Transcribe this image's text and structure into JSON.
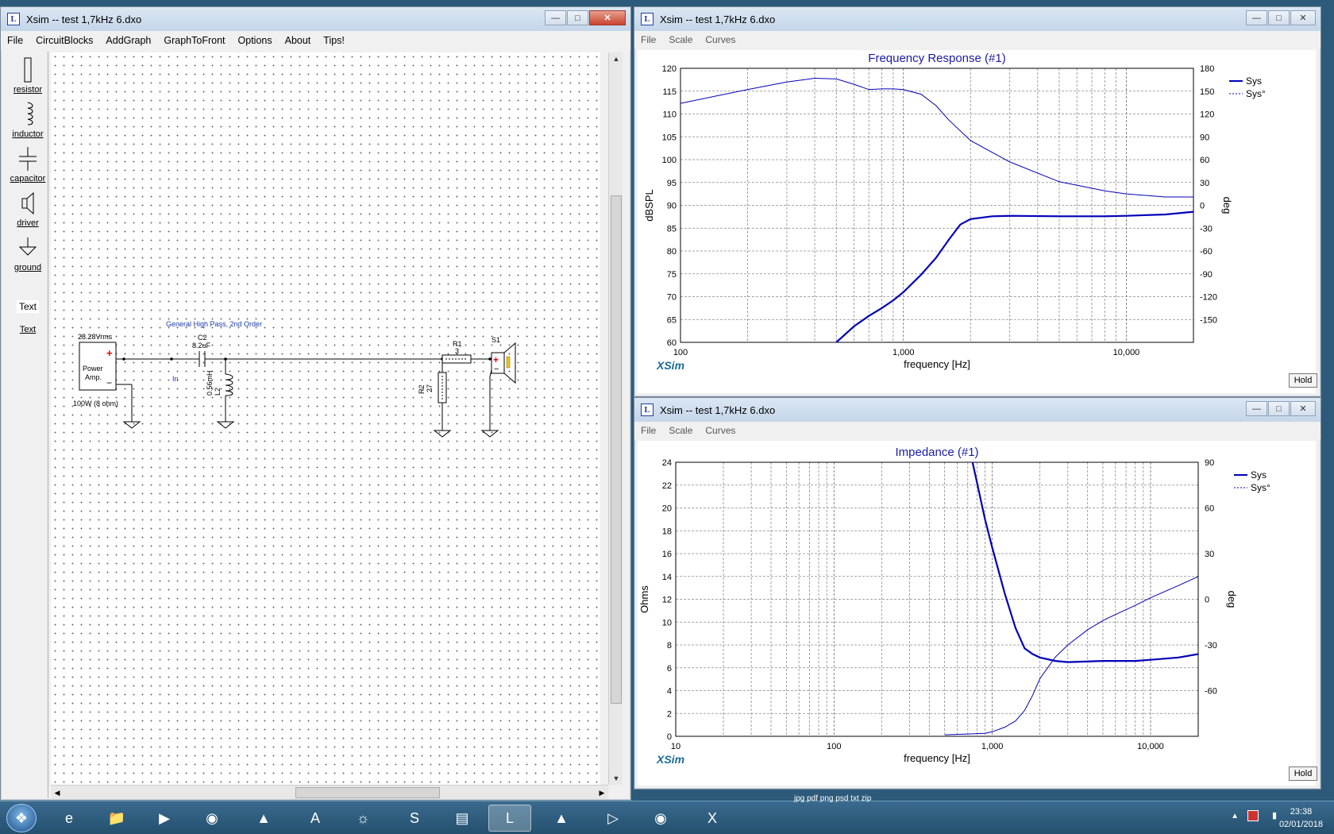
{
  "schematic_window": {
    "title": "Xsim -- test 1,7kHz 6.dxo",
    "menu": [
      "File",
      "CircuitBlocks",
      "AddGraph",
      "GraphToFront",
      "Options",
      "About",
      "Tips!"
    ],
    "toolbox": [
      "resistor",
      "inductor",
      "capacitor",
      "driver",
      "ground"
    ],
    "text_tool_preview": "Text",
    "text_tool_label": "Text",
    "circuit": {
      "block_label": "General High Pass, 2nd Order",
      "source_voltage": "28.28Vrms",
      "source_name_line1": "Power",
      "source_name_line2": "Amp.",
      "source_rating": "100W (8 ohm)",
      "cap_name": "C2",
      "cap_value": "8.2uF",
      "in_label": "In",
      "ind_name": "L2",
      "ind_value": "0.56mH",
      "r1_name": "R1",
      "r1_value": "3",
      "r2_name": "R2",
      "r2_value": "27",
      "speaker_name": "S1"
    }
  },
  "freq_window": {
    "title": "Xsim -- test 1,7kHz 6.dxo",
    "menu": [
      "File",
      "Scale",
      "Curves"
    ],
    "hold_label": "Hold",
    "brand": "XSim"
  },
  "imp_window": {
    "title": "Xsim -- test 1,7kHz 6.dxo",
    "menu": [
      "File",
      "Scale",
      "Curves"
    ],
    "hold_label": "Hold",
    "brand": "XSim"
  },
  "taskbar": {
    "time": "23:38",
    "date": "02/01/2018",
    "background_label": "jpg pdf png psd txt zip"
  },
  "colors": {
    "curve": "#0000b8",
    "title_blue": "#1a1aa8",
    "brand": "#1a6a9a"
  },
  "chart_data": [
    {
      "type": "line",
      "title": "Frequency Response (#1)",
      "xlabel": "frequency [Hz]",
      "ylabel": "dBSPL",
      "y2label": "deg",
      "x_scale": "log",
      "xlim": [
        100,
        20000
      ],
      "ylim": [
        60,
        120
      ],
      "y2lim": [
        -180,
        180
      ],
      "x_tick_labels": [
        "100",
        "1,000",
        "10,000"
      ],
      "y_ticks": [
        "60",
        "65",
        "70",
        "75",
        "80",
        "85",
        "90",
        "95",
        "100",
        "105",
        "110",
        "115",
        "120"
      ],
      "y2_ticks": [
        "-150",
        "-120",
        "-90",
        "-60",
        "-30",
        "0",
        "30",
        "60",
        "90",
        "120",
        "150",
        "180"
      ],
      "grid": true,
      "legend_position": "top-right",
      "series": [
        {
          "name": "Sys",
          "axis": "left",
          "style": "solid",
          "x": [
            500,
            600,
            700,
            800,
            900,
            1000,
            1200,
            1400,
            1600,
            1800,
            2000,
            2500,
            3000,
            5000,
            8000,
            10000,
            15000,
            20000
          ],
          "y": [
            60,
            63.5,
            65.8,
            67.5,
            69.2,
            71,
            74.8,
            78.5,
            82.5,
            85.8,
            87,
            87.6,
            87.7,
            87.6,
            87.6,
            87.7,
            88,
            88.6
          ]
        },
        {
          "name": "Sys°",
          "axis": "right",
          "style": "dashed",
          "x": [
            100,
            200,
            300,
            400,
            500,
            600,
            700,
            800,
            900,
            1000,
            1200,
            1400,
            1600,
            2000,
            3000,
            5000,
            8000,
            10000,
            15000,
            20000
          ],
          "y": [
            134,
            152,
            162,
            167,
            166,
            159,
            152,
            153,
            153,
            152,
            146,
            131,
            112,
            85,
            57,
            31,
            19,
            15,
            11,
            11
          ]
        }
      ]
    },
    {
      "type": "line",
      "title": "Impedance (#1)",
      "xlabel": "frequency [Hz]",
      "ylabel": "Ohms",
      "y2label": "deg",
      "x_scale": "log",
      "xlim": [
        10,
        20000
      ],
      "ylim": [
        0,
        24
      ],
      "y2lim": [
        -90,
        90
      ],
      "x_tick_labels": [
        "10",
        "100",
        "1,000",
        "10,000"
      ],
      "y_ticks": [
        "0",
        "2",
        "4",
        "6",
        "8",
        "10",
        "12",
        "14",
        "16",
        "18",
        "20",
        "22",
        "24"
      ],
      "y2_ticks": [
        "-60",
        "-30",
        "0",
        "30",
        "60",
        "90"
      ],
      "grid": true,
      "legend_position": "top-right",
      "series": [
        {
          "name": "Sys",
          "axis": "left",
          "style": "solid",
          "x": [
            750,
            900,
            1000,
            1200,
            1400,
            1600,
            1800,
            2000,
            2500,
            3000,
            5000,
            8000,
            10000,
            15000,
            20000
          ],
          "y": [
            24,
            19,
            16.5,
            12.5,
            9.5,
            7.7,
            7.2,
            6.9,
            6.6,
            6.5,
            6.6,
            6.6,
            6.7,
            6.9,
            7.2
          ]
        },
        {
          "name": "Sys°",
          "axis": "right",
          "style": "dashed",
          "x": [
            500,
            700,
            900,
            1000,
            1200,
            1400,
            1600,
            1800,
            2000,
            2500,
            3000,
            4000,
            5000,
            6000,
            8000,
            10000,
            15000,
            20000
          ],
          "y": [
            -89,
            -88.5,
            -88,
            -87,
            -84,
            -80,
            -73,
            -63,
            -52,
            -38,
            -30,
            -20,
            -14,
            -10,
            -4,
            1,
            9,
            15
          ]
        }
      ]
    }
  ]
}
